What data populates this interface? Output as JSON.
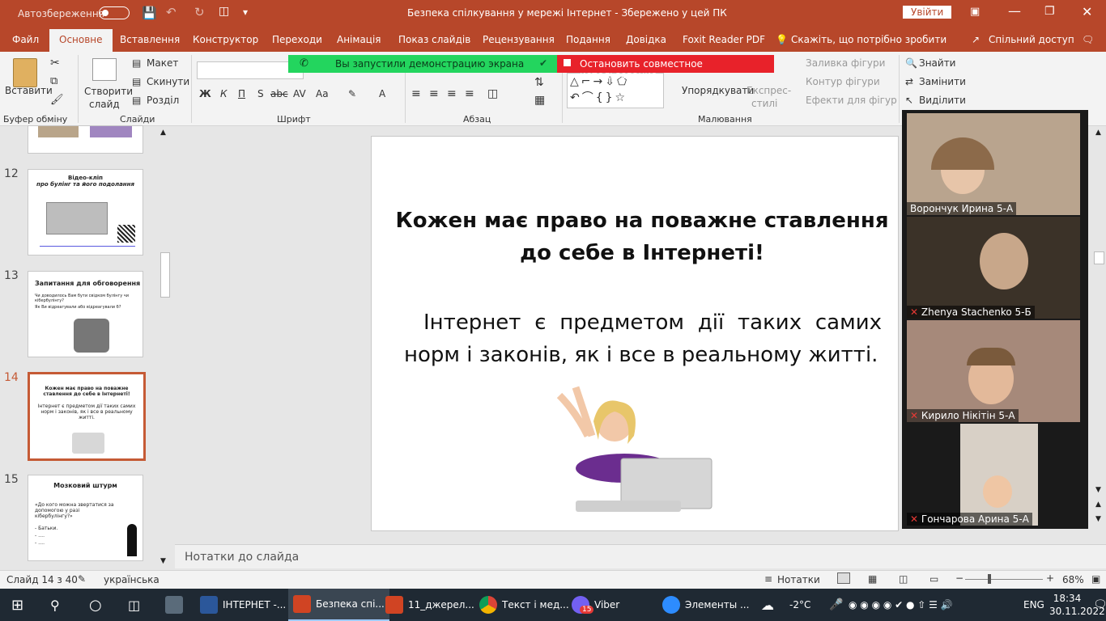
{
  "titlebar": {
    "autosave": "Автозбереження",
    "autosave_state": "Вимк",
    "title": "Безпека спілкування у мережі Інтернет  -  Збережено у цей ПК",
    "signin": "Увійти"
  },
  "tabs": [
    "Файл",
    "Основне",
    "Вставлення",
    "Конструктор",
    "Переходи",
    "Анімація",
    "Показ слайдів",
    "Рецензування",
    "Подання",
    "Довідка",
    "Foxit Reader PDF"
  ],
  "tellme": "Скажіть, що потрібно зробити",
  "share": "Спільний доступ",
  "ribbon": {
    "paste": "Вставити",
    "clipboard": "Буфер обміну",
    "new_slide": "Створити",
    "new_slide2": "слайд",
    "layout": "Макет",
    "reset": "Скинути",
    "section": "Розділ",
    "slides": "Слайди",
    "font": "Шрифт",
    "paragraph": "Абзац",
    "arrange": "Упорядкувати",
    "quick_styles": "Експрес-",
    "quick_styles2": "стилі",
    "fill": "Заливка фігури",
    "outline": "Контур фігури",
    "effects": "Ефекти для фігур",
    "drawing": "Малювання",
    "find": "Знайти",
    "replace": "Замінити",
    "select": "Виділити"
  },
  "banner": {
    "green": "Вы запустили демонстрацию экрана",
    "red": "Остановить совместное использование"
  },
  "thumbs": [
    {
      "num": "12",
      "title": "Відео-кліп",
      "subtitle": "про булінг та його подолання"
    },
    {
      "num": "13",
      "title": "Запитання для обговорення",
      "b1": "Чи доводилось Вам бути свідком булінгу чи кібербулінгу?",
      "b2": "Як Ви відреагували або відреагували б?"
    },
    {
      "num": "14",
      "title": "Кожен має право на поважне ставлення до себе в Інтернеті!",
      "body": "Інтернет є предметом дії таких самих норм і законів, як і все в реальному житті."
    },
    {
      "num": "15",
      "title": "Мозковий штурм",
      "body": "«До кого можна звертатися за допомогою у разі кібербулінгу?»",
      "b1": "- Батьки.",
      "b2": "- ….",
      "b3": "- …."
    }
  ],
  "slide": {
    "title1": "Кожен має право на поважне ставлення",
    "title2": "до себе в Інтернеті!",
    "body1": "Інтернет є предметом дії таких самих",
    "body2": "норм і законів, як і все в реальному житті."
  },
  "notes": "Нотатки до слайда",
  "participants": [
    {
      "name": "Ворончук Ирина 5-А",
      "muted": false
    },
    {
      "name": "Zhenya Stachenko 5-Б",
      "muted": true
    },
    {
      "name": "Кирило Нікітін 5-А",
      "muted": true
    },
    {
      "name": "Гончарова Арина 5-А",
      "muted": true
    }
  ],
  "status": {
    "slide": "Слайд 14 з 40",
    "lang": "українська",
    "notes": "Нотатки",
    "zoom": "68%"
  },
  "taskbar": {
    "items": [
      "ІНТЕРНЕТ -...",
      "Безпека спі...",
      "11_джерел...",
      "Текст і мед...",
      "Viber",
      "Элементы ..."
    ],
    "viber_badge": "15",
    "weather": "-2°C",
    "lang": "ENG",
    "time": "18:34",
    "date": "30.11.2022"
  }
}
